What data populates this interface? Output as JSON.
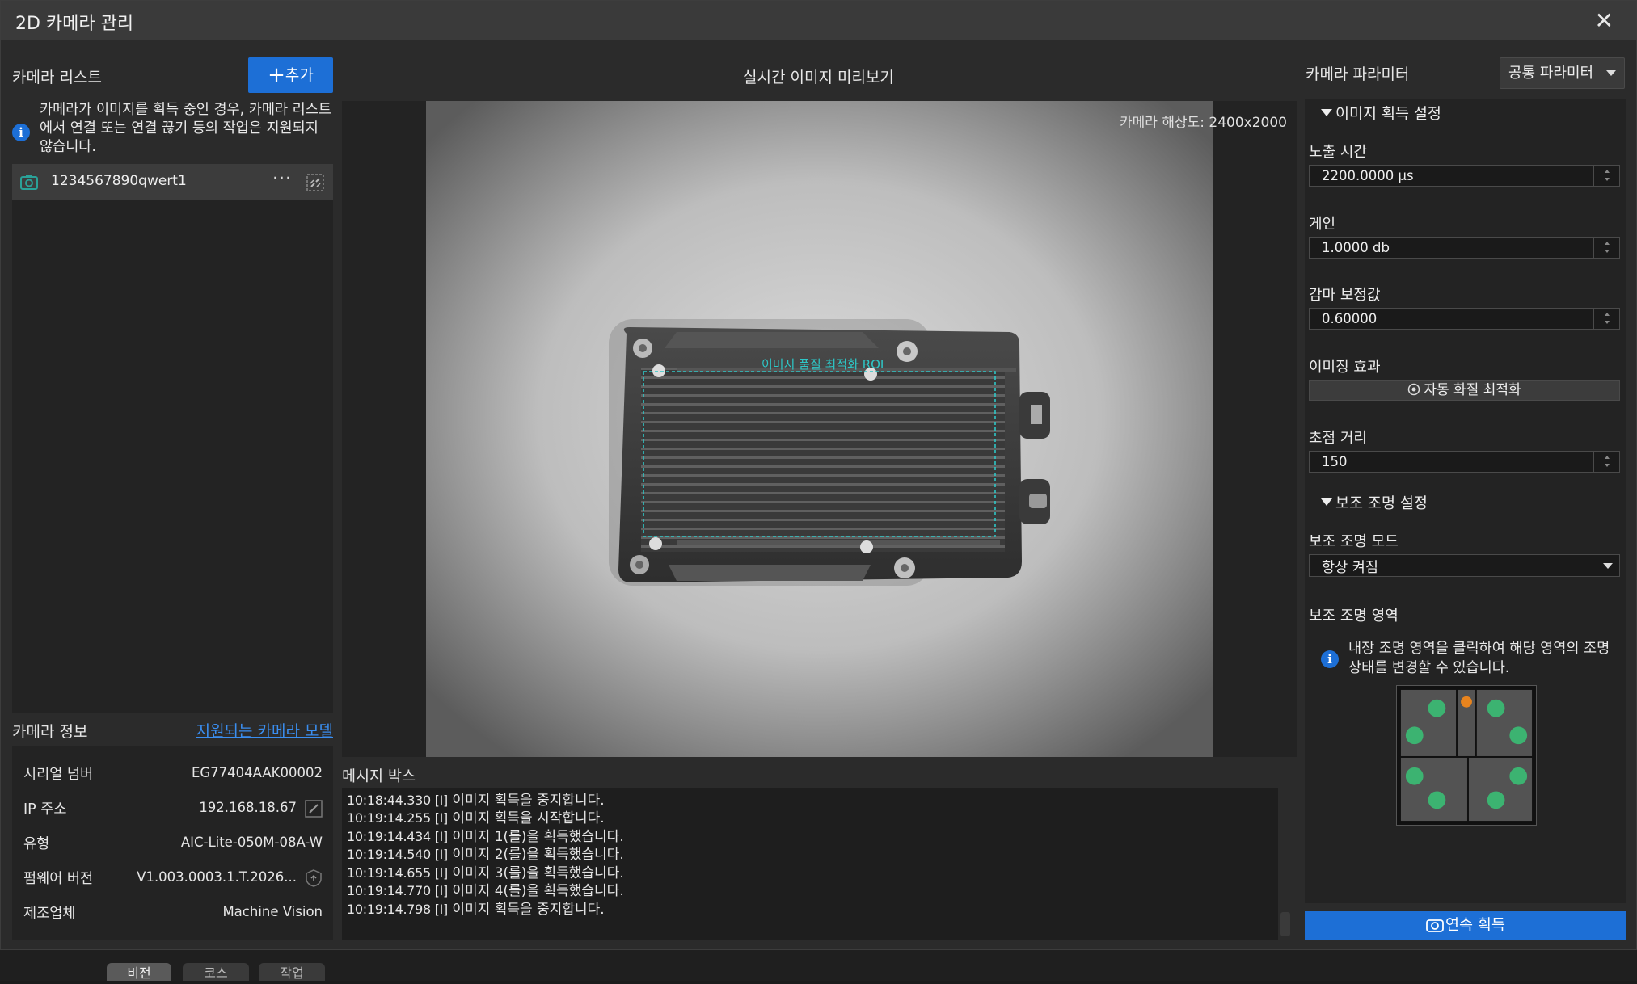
{
  "window": {
    "title": "2D 카메라 관리",
    "close_glyph": "✕"
  },
  "left": {
    "camera_list_title": "카메라 리스트",
    "add_button_label": "추가",
    "add_button_glyph": "+",
    "notice_text": "카메라가 이미지를 획득 중인 경우, 카메라 리스트에서 연결 또는 연결 끊기 등의 작업은 지원되지 않습니다.",
    "cameras": [
      {
        "name": "1234567890qwert1",
        "more_glyph": "···"
      }
    ],
    "camera_info_title": "카메라 정보",
    "supported_models_link": "지원되는 카메라 모델",
    "info_rows": [
      {
        "key": "시리얼 넘버",
        "value": "EG77404AAK00002"
      },
      {
        "key": "IP 주소",
        "value": "192.168.18.67"
      },
      {
        "key": "유형",
        "value": "AIC-Lite-050M-08A-W"
      },
      {
        "key": "펌웨어 버전",
        "value": "V1.003.0003.1.T.2026..."
      },
      {
        "key": "제조업체",
        "value": "Machine Vision"
      }
    ]
  },
  "center": {
    "preview_title": "실시간 이미지 미리보기",
    "resolution": "카메라 해상도: 2400x2000",
    "roi_label": "이미지 품질 최적화 ROI",
    "message_box_title": "메시지 박스",
    "messages": [
      {
        "ts": "10:18:44.330 [I]",
        "text": "이미지 획득을 중지합니다."
      },
      {
        "ts": "10:19:14.255 [I]",
        "text": "이미지 획득을 시작합니다."
      },
      {
        "ts": "10:19:14.434 [I]",
        "text": "이미지 1(를)을 획득했습니다."
      },
      {
        "ts": "10:19:14.540 [I]",
        "text": "이미지 2(를)을 획득했습니다."
      },
      {
        "ts": "10:19:14.655 [I]",
        "text": "이미지 3(를)을 획득했습니다."
      },
      {
        "ts": "10:19:14.770 [I]",
        "text": "이미지 4(를)을 획득했습니다."
      },
      {
        "ts": "10:19:14.798 [I]",
        "text": "이미지 획득을 중지합니다."
      }
    ]
  },
  "right": {
    "title": "카메라 파라미터",
    "common_params_label": "공통 파라미터",
    "acq_group": "이미지 획득 설정",
    "exposure_label": "노출 시간",
    "exposure_value": "2200.0000 μs",
    "gain_label": "게인",
    "gain_value": "1.0000 db",
    "gamma_label": "감마 보정값",
    "gamma_value": "0.60000",
    "imaging_effect_label": "이미징 효과",
    "auto_optimize_label": "자동 화질 최적화",
    "focus_label": "초점 거리",
    "focus_value": "150",
    "aux_group": "보조 조명 설정",
    "aux_mode_label": "보조 조명 모드",
    "aux_mode_value": "항상 켜짐",
    "aux_area_label": "보조 조명 영역",
    "aux_area_note": "내장 조명 영역을 클릭하여 해당 영역의 조명 상태를 변경할 수 있습니다.",
    "continuous_acquire_label": "연속 획득",
    "light_on_color": "#3cb371",
    "light_center_color": "#e8841e"
  },
  "background_tabs": [
    "비전",
    "코스",
    "작업"
  ],
  "colors": {
    "accent": "#1d6fd6",
    "link": "#3a8ef0",
    "roi": "#2ec7c7"
  }
}
